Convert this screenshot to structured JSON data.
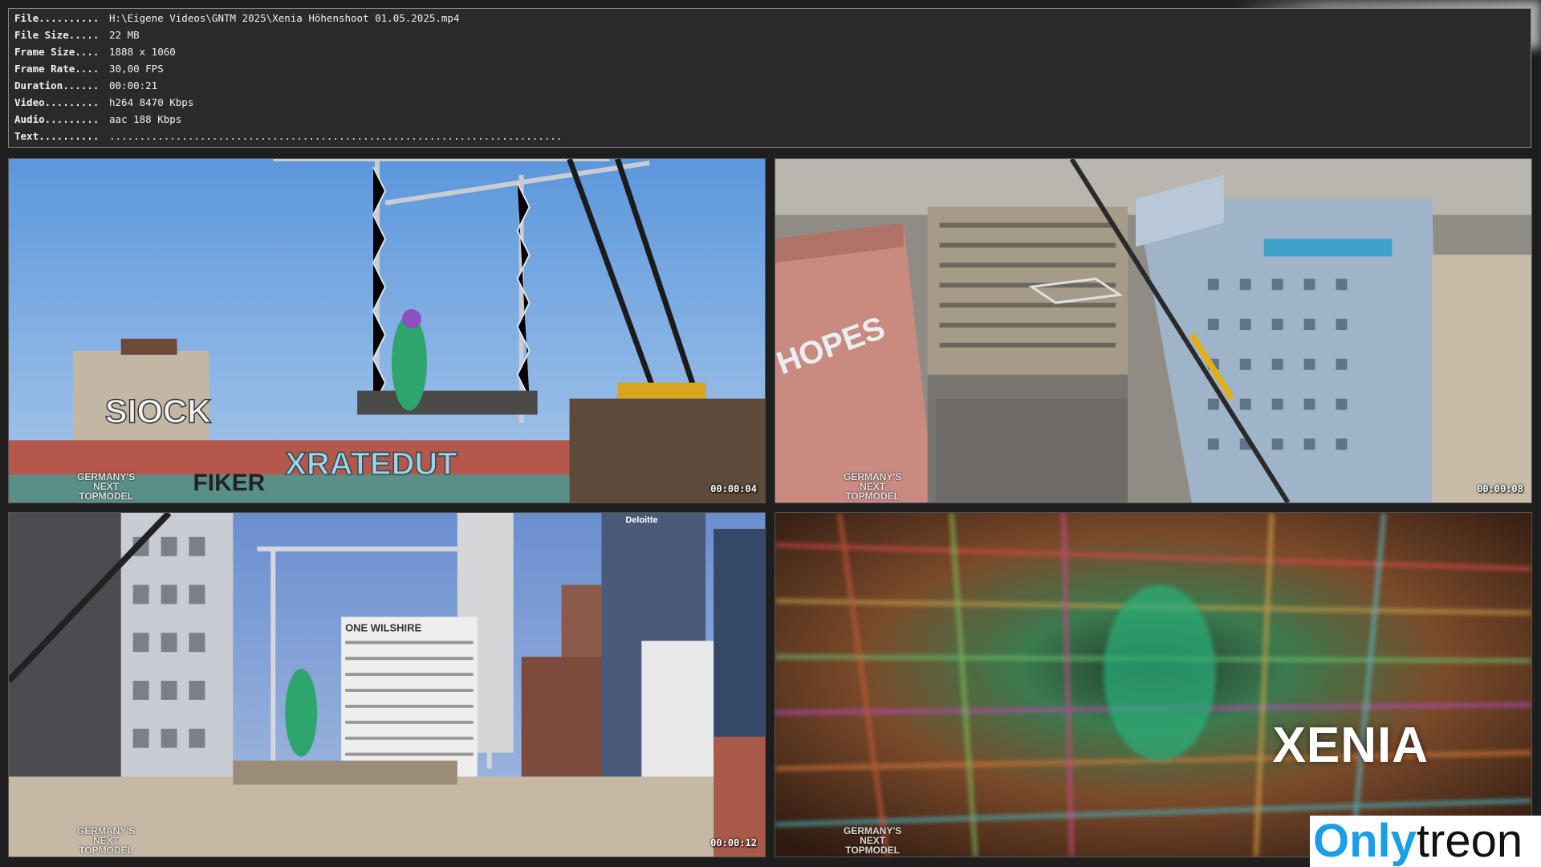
{
  "info": [
    {
      "label": "File..........",
      "value": "H:\\Eigene Videos\\GNTM 2025\\Xenia Höhenshoot 01.05.2025.mp4"
    },
    {
      "label": "File Size.....",
      "value": "22 MB"
    },
    {
      "label": "Frame Size....",
      "value": "1888 x 1060"
    },
    {
      "label": "Frame Rate....",
      "value": "30,00 FPS"
    },
    {
      "label": "Duration......",
      "value": "00:00:21"
    },
    {
      "label": "Video.........",
      "value": "h264 8470 Kbps"
    },
    {
      "label": "Audio.........",
      "value": "aac 188 Kbps"
    },
    {
      "label": "Text..........",
      "value": "..........................................................................."
    }
  ],
  "thumbnails": [
    {
      "timestamp": "00:00:04",
      "logo": "GERMANY'S\nNEXT\nTOPMODEL",
      "graffiti": [
        "SIOCK",
        "XRATEDUT",
        "FIKER"
      ]
    },
    {
      "timestamp": "00:00:08",
      "logo": "GERMANY'S\nNEXT\nTOPMODEL",
      "building_sign": "HOPES"
    },
    {
      "timestamp": "00:00:12",
      "logo": "GERMANY'S\nNEXT\nTOPMODEL",
      "building_sign": "ONE WILSHIRE",
      "tower_sign": "Deloitte"
    },
    {
      "timestamp": "",
      "logo": "GERMANY'S\nNEXT\nTOPMODEL",
      "title": "XENIA"
    }
  ],
  "watermark": {
    "part1": "Only",
    "part2": "treon"
  },
  "colors": {
    "panel_bg": "#2a2a2a",
    "page_bg": "#1e1e1e",
    "sky": "#6fa3e0",
    "watermark_blue": "#1a9ee6"
  }
}
